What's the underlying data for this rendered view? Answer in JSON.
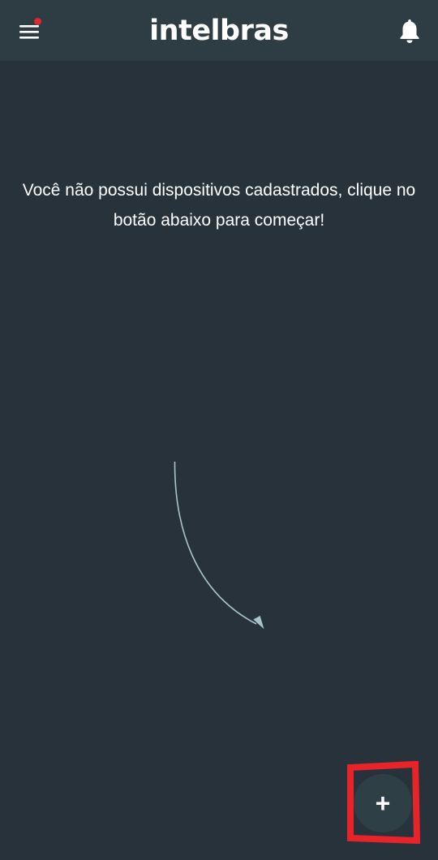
{
  "header": {
    "brand": "intelbras",
    "menu_icon": "hamburger-menu-icon",
    "menu_badge_color": "#e0282e",
    "notification_icon": "bell-icon"
  },
  "main": {
    "empty_message": "Você não possui dispositivos cadastrados, clique no botão abaixo para começar!",
    "pointer_icon": "curved-arrow-icon"
  },
  "fab": {
    "label": "+",
    "icon": "plus-icon",
    "highlight_color": "#e8232a"
  },
  "colors": {
    "background": "#28323a",
    "header": "#2e3c44",
    "fab": "#2f3f46",
    "arrow": "#a9c4cc"
  }
}
